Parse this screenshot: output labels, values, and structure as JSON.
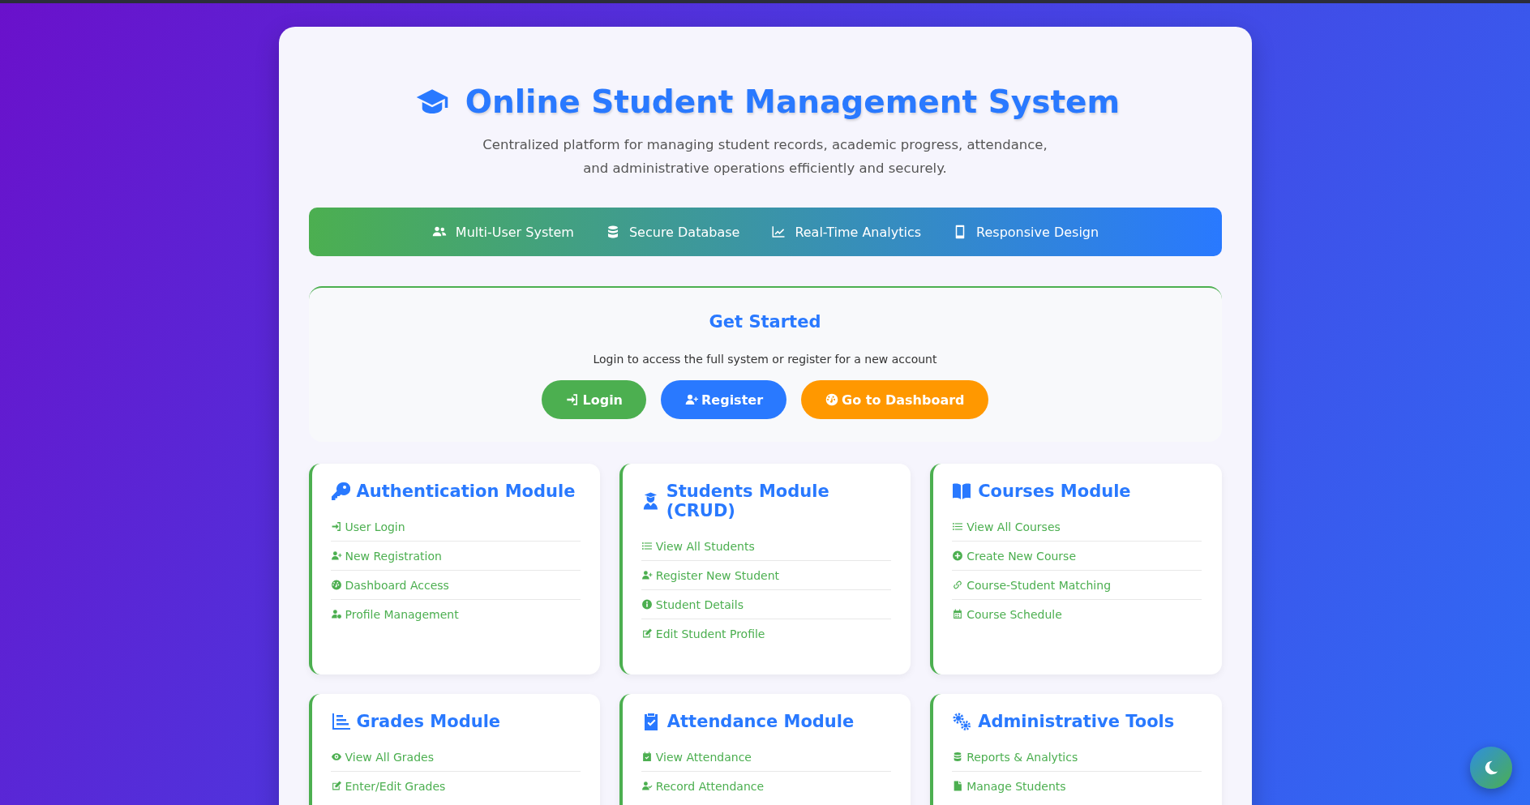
{
  "header": {
    "title": "Online Student Management System",
    "subtitle": "Centralized platform for managing student records, academic progress, attendance, and administrative operations efficiently and securely."
  },
  "features": [
    {
      "label": "Multi-User System"
    },
    {
      "label": "Secure Database"
    },
    {
      "label": "Real-Time Analytics"
    },
    {
      "label": "Responsive Design"
    }
  ],
  "get_started": {
    "title": "Get Started",
    "text": "Login to access the full system or register for a new account",
    "buttons": [
      {
        "label": "Login",
        "kind": "login"
      },
      {
        "label": "Register",
        "kind": "register"
      },
      {
        "label": "Go to Dashboard",
        "kind": "dashboard"
      }
    ]
  },
  "modules": [
    {
      "title": "Authentication Module",
      "items": [
        "User Login",
        "New Registration",
        "Dashboard Access",
        "Profile Management"
      ]
    },
    {
      "title": "Students Module (CRUD)",
      "items": [
        "View All Students",
        "Register New Student",
        "Student Details",
        "Edit Student Profile"
      ]
    },
    {
      "title": "Courses Module",
      "items": [
        "View All Courses",
        "Create New Course",
        "Course-Student Matching",
        "Course Schedule"
      ]
    },
    {
      "title": "Grades Module",
      "items": [
        "View All Grades",
        "Enter/Edit Grades"
      ]
    },
    {
      "title": "Attendance Module",
      "items": [
        "View Attendance",
        "Record Attendance"
      ]
    },
    {
      "title": "Administrative Tools",
      "items": [
        "Reports & Analytics",
        "Manage Students"
      ]
    }
  ]
}
